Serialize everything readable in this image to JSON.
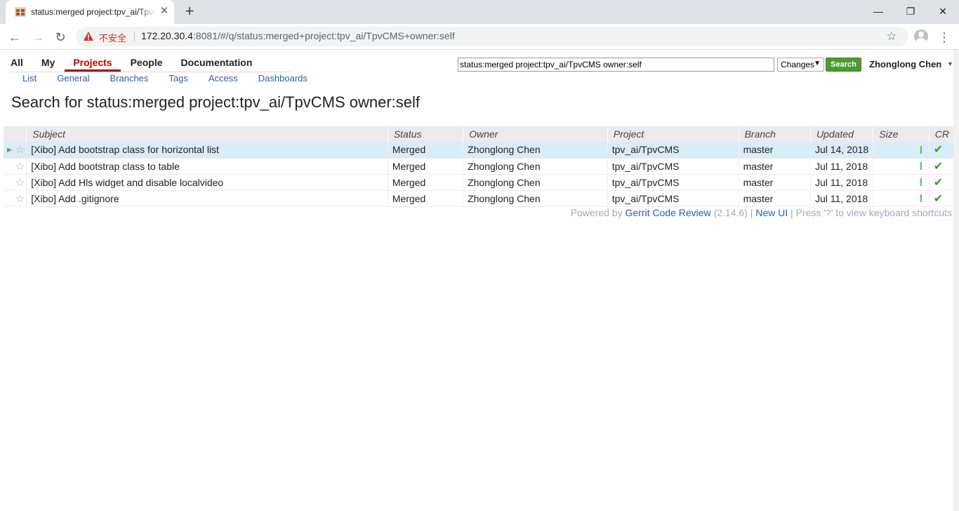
{
  "browser": {
    "tab_title": "status:merged project:tpv_ai/TpvCMS owner:self",
    "insecure_label": "不安全",
    "url_host": "172.20.30.4",
    "url_rest": ":8081/#/q/status:merged+project:tpv_ai/TpvCMS+owner:self"
  },
  "nav": {
    "top_menu": [
      "All",
      "My",
      "Projects",
      "People",
      "Documentation"
    ],
    "active_top": "Projects",
    "sub_menu": [
      "List",
      "General",
      "Branches",
      "Tags",
      "Access",
      "Dashboards"
    ]
  },
  "search": {
    "query": "status:merged project:tpv_ai/TpvCMS owner:self",
    "scope": "Changes",
    "button": "Search"
  },
  "user": {
    "name": "Zhonglong Chen"
  },
  "heading": "Search for status:merged project:tpv_ai/TpvCMS owner:self",
  "table": {
    "columns": [
      "Subject",
      "Status",
      "Owner",
      "Project",
      "Branch",
      "Updated",
      "Size",
      "CR"
    ],
    "rows": [
      {
        "subject": "[Xibo] Add bootstrap class for horizontal list",
        "status": "Merged",
        "owner": "Zhonglong Chen",
        "project": "tpv_ai/TpvCMS",
        "branch": "master",
        "updated": "Jul 14, 2018"
      },
      {
        "subject": "[Xibo] Add bootstrap class to table",
        "status": "Merged",
        "owner": "Zhonglong Chen",
        "project": "tpv_ai/TpvCMS",
        "branch": "master",
        "updated": "Jul 11, 2018"
      },
      {
        "subject": "[Xibo] Add Hls widget and disable localvideo",
        "status": "Merged",
        "owner": "Zhonglong Chen",
        "project": "tpv_ai/TpvCMS",
        "branch": "master",
        "updated": "Jul 11, 2018"
      },
      {
        "subject": "[Xibo] Add .gitignore",
        "status": "Merged",
        "owner": "Zhonglong Chen",
        "project": "tpv_ai/TpvCMS",
        "branch": "master",
        "updated": "Jul 11, 2018"
      }
    ]
  },
  "footer": {
    "powered_by": "Powered by",
    "gerrit_link": "Gerrit Code Review",
    "version": "(2.14.6) |",
    "new_ui": "New UI",
    "shortcuts": "| Press '?' to view keyboard shortcuts"
  }
}
